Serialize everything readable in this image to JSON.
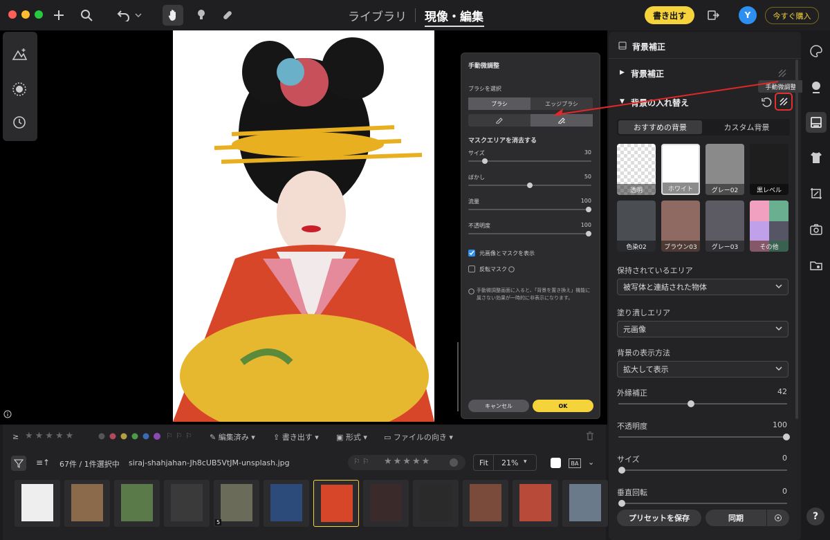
{
  "window": {
    "dots": [
      "#ff5f57",
      "#febc2e",
      "#28c840"
    ]
  },
  "nav": {
    "library": "ライブラリ",
    "develop": "現像・編集"
  },
  "header": {
    "export": "書き出す",
    "avatar": "Y",
    "buy": "今すぐ購入"
  },
  "brush_panel": {
    "title": "手動微調整",
    "select_brush": "ブラシを選択",
    "brush_tabs": [
      "ブラシ",
      "エッジブラシ"
    ],
    "erase_title": "マスクエリアを消去する",
    "sliders": [
      {
        "label": "サイズ",
        "value": "30",
        "level": 0.12
      },
      {
        "label": "ぼかし",
        "value": "50",
        "level": 0.5
      },
      {
        "label": "流量",
        "value": "100",
        "level": 1.0
      },
      {
        "label": "不透明度",
        "value": "100",
        "level": 1.0
      }
    ],
    "show_original": "元画像とマスクを表示",
    "invert_mask": "反転マスク",
    "note": "手動微調整画面に入ると、「背景を置き換え」機能に属さない効果が一時的に非表示になります。",
    "cancel": "キャンセル",
    "ok": "OK"
  },
  "filmstrip": {
    "edited": "編集済み",
    "export": "書き出す",
    "format": "形式",
    "orientation": "ファイルの向き",
    "count": "67件 / 1件選択中",
    "filename": "siraj-shahjahan-Jh8cUB5VtJM-unsplash.jpg",
    "fit": "Fit",
    "zoom": "21%",
    "ba": "BA",
    "badge": "5",
    "thumb_colors": [
      "#eeeeee",
      "#8a6a4a",
      "#5a7a4a",
      "#3a3a3a",
      "#6b6b5a",
      "#2c4a7a",
      "#d8462a",
      "#3a2a2a",
      "#2a2a2a",
      "#7a4a3a",
      "#b84a3a",
      "#6a7a8a"
    ]
  },
  "right_panel": {
    "header": "背景補正",
    "section1": "背景補正",
    "section2": "背景の入れ替え",
    "tooltip": "手動微調整",
    "tabs": [
      "おすすめの背景",
      "カスタム背景"
    ],
    "backgrounds": [
      {
        "label": "透明",
        "color": "checker"
      },
      {
        "label": "ホワイト",
        "color": "#ffffff"
      },
      {
        "label": "グレー02",
        "color": "#8a8a8a"
      },
      {
        "label": "黒レベル",
        "color": "#1e1e1e"
      },
      {
        "label": "色染02",
        "color": "#4a4e52"
      },
      {
        "label": "ブラウン03",
        "color": "#8e6a62"
      },
      {
        "label": "グレー03",
        "color": "#5c5a62"
      },
      {
        "label": "その他",
        "color": "multi"
      }
    ],
    "keep_area_label": "保持されているエリア",
    "keep_area_value": "被写体と連結された物体",
    "fill_area_label": "塗り潰しエリア",
    "fill_area_value": "元画像",
    "display_label": "背景の表示方法",
    "display_value": "拡大して表示",
    "sliders": [
      {
        "label": "外縁補正",
        "value": "42",
        "level": 0.42
      },
      {
        "label": "不透明度",
        "value": "100",
        "level": 1.0
      },
      {
        "label": "サイズ",
        "value": "0",
        "level": 0.0
      },
      {
        "label": "垂直回転",
        "value": "0",
        "level": 0.0
      }
    ],
    "save_preset": "プリセットを保存",
    "sync": "同期"
  },
  "help": "?"
}
